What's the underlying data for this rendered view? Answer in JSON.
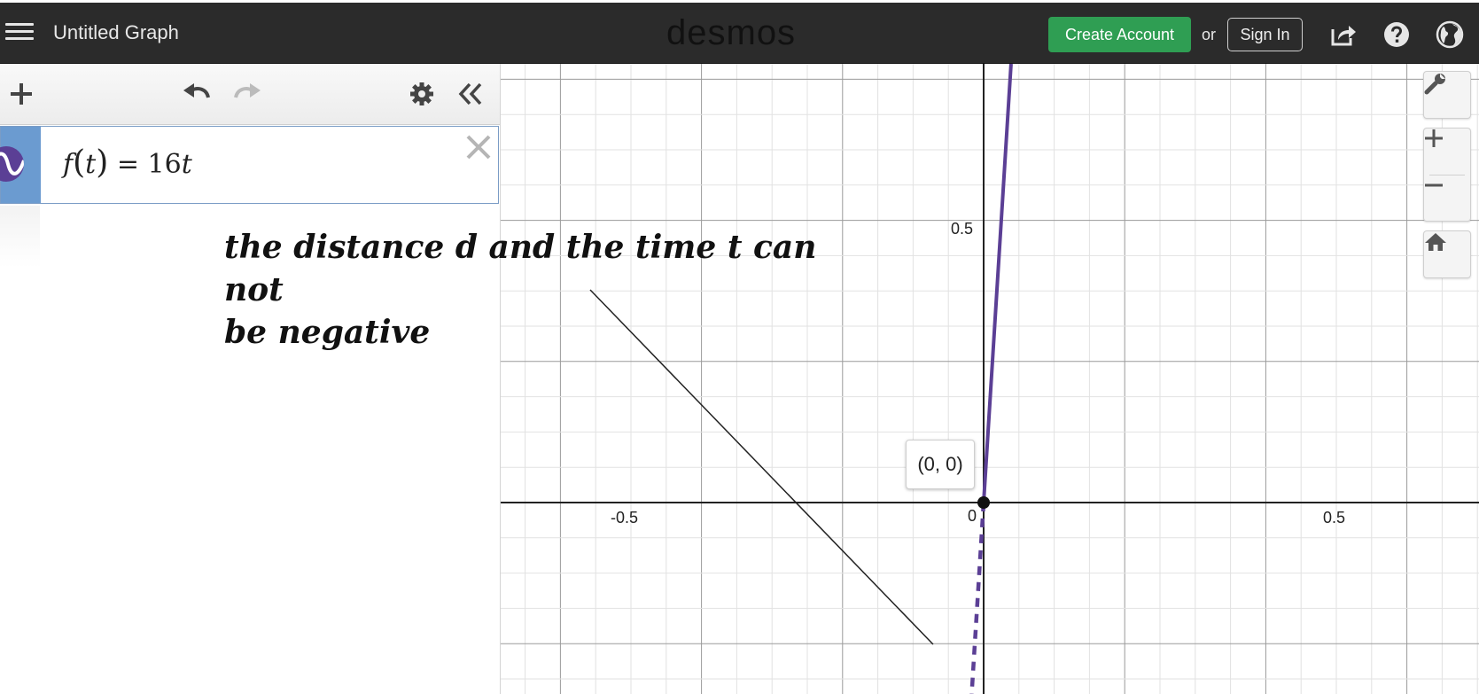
{
  "topbar": {
    "graph_title": "Untitled Graph",
    "logo": "desmos",
    "create_account_label": "Create Account",
    "or_text": "or",
    "sign_in_label": "Sign In",
    "accent_color": "#2f9e53",
    "icons": [
      "menu-icon",
      "share-icon",
      "help-icon",
      "language-globe-icon"
    ]
  },
  "expressions": {
    "toolbar_icons": [
      "add-icon",
      "undo-icon",
      "redo-icon",
      "settings-gear-icon",
      "collapse-panel-icon"
    ],
    "items": [
      {
        "func": "f",
        "var": "t",
        "equals": "=",
        "coef": "16",
        "color": "#5b3f95"
      }
    ]
  },
  "graph": {
    "curve_color": "#5b3f95",
    "x_ticks": [
      "-0.5",
      "0",
      "0.5"
    ],
    "y_ticks": [
      "0.5"
    ],
    "point_label": "(0, 0)",
    "controls": [
      "wrench-icon",
      "zoom-in-icon",
      "zoom-out-icon",
      "home-icon"
    ]
  },
  "annotation": {
    "line1": "the distance d and the time t can not",
    "line2": "be negative"
  }
}
